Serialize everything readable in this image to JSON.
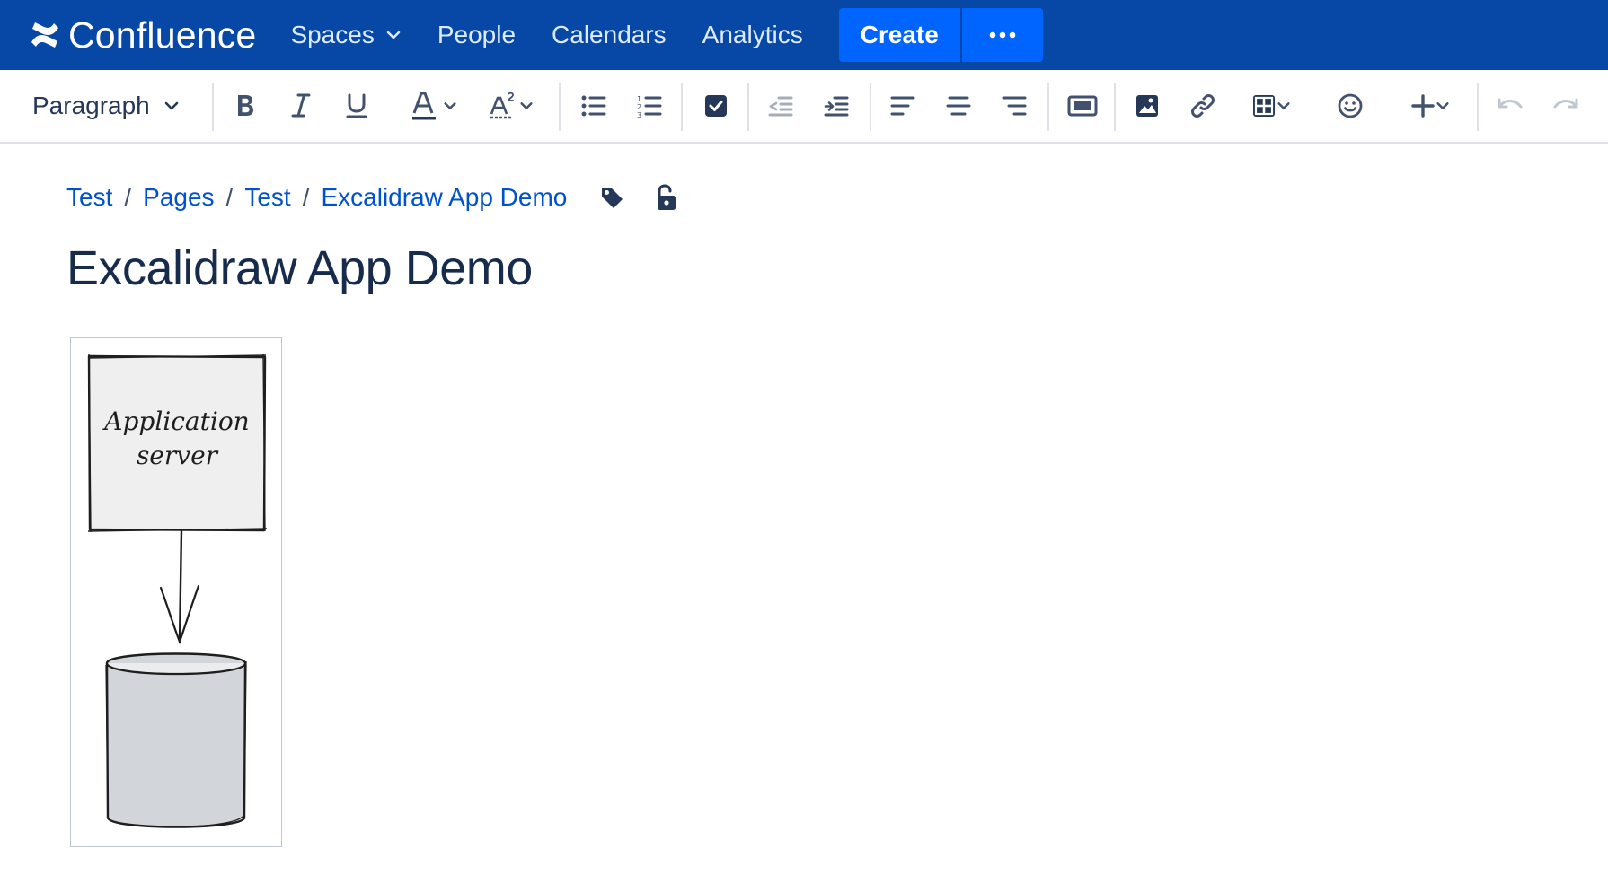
{
  "app": {
    "name": "Confluence"
  },
  "nav": {
    "spaces": "Spaces",
    "people": "People",
    "calendars": "Calendars",
    "analytics": "Analytics",
    "create": "Create"
  },
  "toolbar": {
    "paragraph": "Paragraph"
  },
  "breadcrumb": [
    "Test",
    "Pages",
    "Test",
    "Excalidraw App Demo"
  ],
  "page": {
    "title": "Excalidraw App Demo"
  },
  "diagram": {
    "box_line1": "Application",
    "box_line2": "server",
    "box_fill": "#efefef",
    "cylinder_fill": "#d2d5da"
  },
  "colors": {
    "nav_bg": "#0747a6",
    "create_bg": "#0065ff",
    "link": "#0052cc"
  }
}
